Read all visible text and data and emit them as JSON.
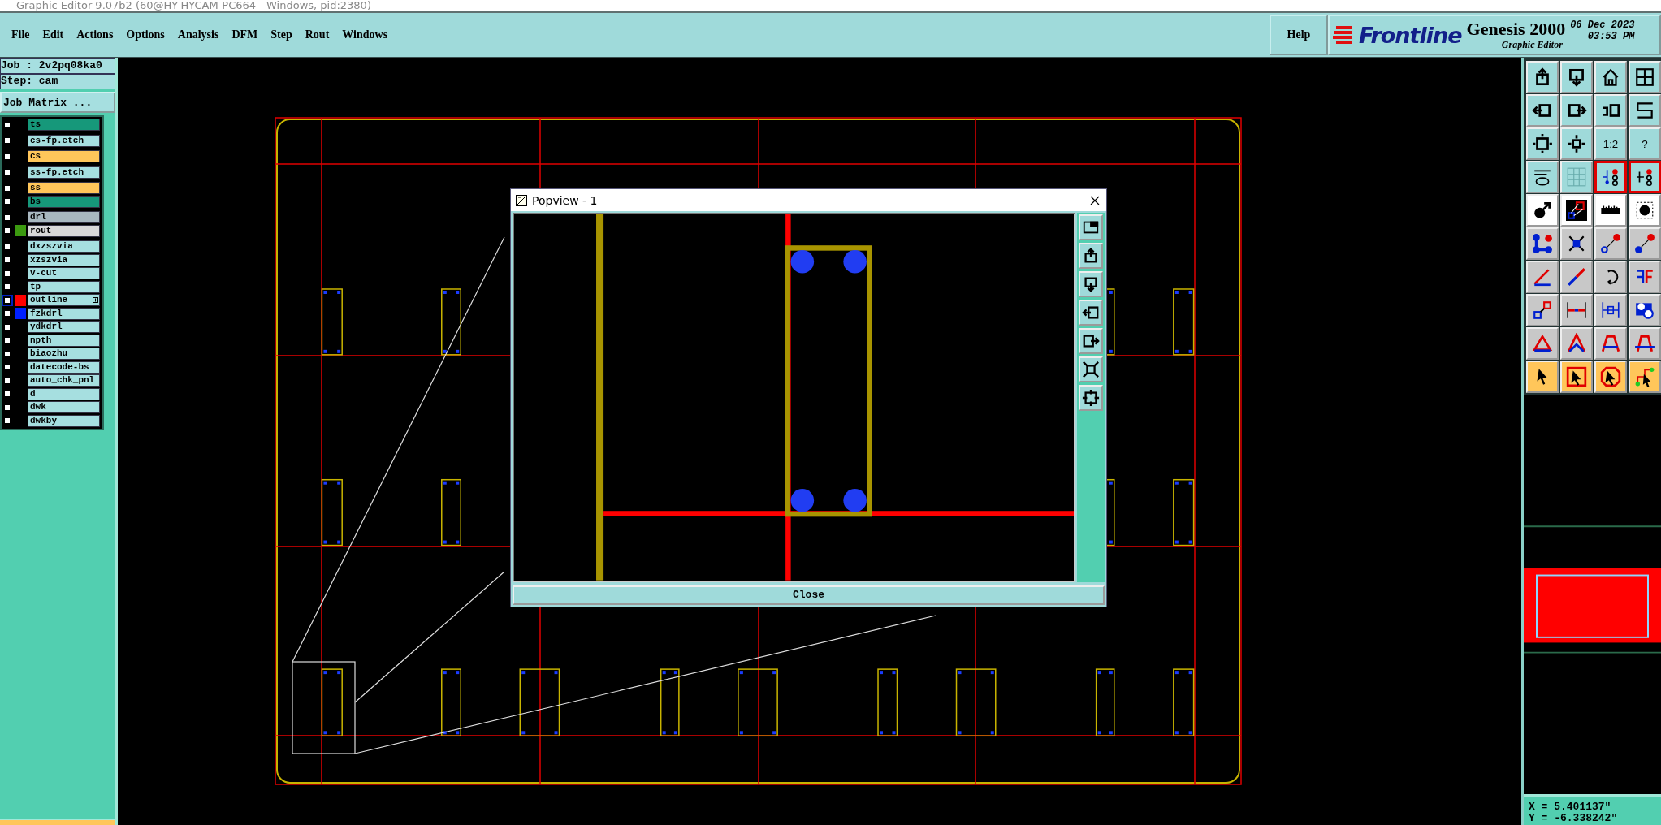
{
  "window": {
    "title": "Graphic Editor 9.07b2 (60@HY-HYCAM-PC664 - Windows, pid:2380)"
  },
  "menu": [
    "File",
    "Edit",
    "Actions",
    "Options",
    "Analysis",
    "DFM",
    "Step",
    "Rout",
    "Windows"
  ],
  "help": "Help",
  "brand": {
    "logo": "Frontline",
    "product": "Genesis 2000",
    "subtitle": "Graphic Editor",
    "date": "06 Dec 2023",
    "time": "03:53 PM"
  },
  "job": {
    "job": "Job : 2v2pq08ka0",
    "step": "Step: cam",
    "matrix_button": "Job Matrix ..."
  },
  "layer_groups": [
    [
      {
        "name": "ts",
        "color": "#16987a",
        "checked": false,
        "focused": false,
        "expandable": false
      }
    ],
    [
      {
        "name": "cs-fp.etch",
        "color": "#a6dfe0",
        "checked": false,
        "focused": false,
        "expandable": false
      }
    ],
    [
      {
        "name": "cs",
        "color": "#ffc65a",
        "checked": false,
        "focused": false,
        "expandable": false
      }
    ],
    [
      {
        "name": "ss-fp.etch",
        "color": "#a6dfe0",
        "checked": false,
        "focused": false,
        "expandable": false
      }
    ],
    [
      {
        "name": "ss",
        "color": "#ffc65a",
        "checked": false,
        "focused": false,
        "expandable": false
      },
      {
        "name": "bs",
        "color": "#16987a",
        "checked": false,
        "focused": false,
        "expandable": false
      }
    ],
    [
      {
        "name": "drl",
        "color": "#a8b8c0",
        "checked": false,
        "focused": false,
        "expandable": false
      },
      {
        "name": "rout",
        "color": "#d8d8d8",
        "swatch": {
          "color": "#3c9a10"
        },
        "checked": false,
        "focused": false,
        "expandable": false
      }
    ],
    [
      {
        "name": "dxzszvia",
        "color": "#a6dfe0",
        "checked": false,
        "focused": false,
        "expandable": false
      },
      {
        "name": "xzszvia",
        "color": "#a6dfe0",
        "checked": false,
        "focused": false,
        "expandable": false
      },
      {
        "name": "v-cut",
        "color": "#a6dfe0",
        "checked": false,
        "focused": false,
        "expandable": false
      },
      {
        "name": "tp",
        "color": "#a6dfe0",
        "checked": false,
        "focused": false,
        "expandable": false
      },
      {
        "name": "outline",
        "color": "#a6dfe0",
        "swatch": {
          "color": "#ff0000"
        },
        "checked": false,
        "focused": true,
        "expandable": true
      },
      {
        "name": "fzkdrl",
        "color": "#a6dfe0",
        "swatch": {
          "color": "#0020ff"
        },
        "checked": false,
        "focused": false,
        "expandable": false
      },
      {
        "name": "ydkdrl",
        "color": "#a6dfe0",
        "checked": false,
        "focused": false,
        "expandable": false
      },
      {
        "name": "npth",
        "color": "#a6dfe0",
        "checked": false,
        "focused": false,
        "expandable": false
      },
      {
        "name": "biaozhu",
        "color": "#a6dfe0",
        "checked": false,
        "focused": false,
        "expandable": false
      },
      {
        "name": "datecode-bs",
        "color": "#a6dfe0",
        "checked": false,
        "focused": false,
        "expandable": false
      },
      {
        "name": "auto_chk_pnl",
        "color": "#a6dfe0",
        "checked": false,
        "focused": false,
        "expandable": false
      },
      {
        "name": "d",
        "color": "#a6dfe0",
        "checked": false,
        "focused": false,
        "expandable": false
      },
      {
        "name": "dwk",
        "color": "#a6dfe0",
        "checked": false,
        "focused": false,
        "expandable": false
      },
      {
        "name": "dwkby",
        "color": "#a6dfe0",
        "checked": false,
        "focused": false,
        "expandable": false
      }
    ]
  ],
  "popview": {
    "title": "Popview - 1",
    "close_button": "Close"
  },
  "tools": [
    {
      "kind": "nav",
      "active": false
    },
    {
      "kind": "nav",
      "active": false
    },
    {
      "kind": "nav",
      "active": false
    },
    {
      "kind": "nav",
      "active": false
    },
    {
      "kind": "nav",
      "active": false
    },
    {
      "kind": "nav",
      "active": false
    },
    {
      "kind": "nav",
      "active": false
    },
    {
      "kind": "nav",
      "active": false
    },
    {
      "kind": "nav",
      "active": false
    },
    {
      "kind": "nav",
      "active": false
    },
    {
      "kind": "nav",
      "active": false,
      "label": "1:2"
    },
    {
      "kind": "nav",
      "active": false,
      "label": "?"
    },
    {
      "kind": "nav",
      "active": false
    },
    {
      "kind": "nav",
      "active": false
    },
    {
      "kind": "nav",
      "active": true
    },
    {
      "kind": "nav",
      "active": true
    },
    {
      "kind": "measure",
      "active": false
    },
    {
      "kind": "measure",
      "active": false
    },
    {
      "kind": "measure",
      "active": false
    },
    {
      "kind": "measure",
      "active": false
    },
    {
      "kind": "edit",
      "active": false
    },
    {
      "kind": "edit",
      "active": false
    },
    {
      "kind": "edit",
      "active": false
    },
    {
      "kind": "edit",
      "active": false
    },
    {
      "kind": "edit",
      "active": false
    },
    {
      "kind": "edit",
      "active": false
    },
    {
      "kind": "edit",
      "active": false
    },
    {
      "kind": "edit",
      "active": false
    },
    {
      "kind": "edit",
      "active": false
    },
    {
      "kind": "edit",
      "active": false
    },
    {
      "kind": "edit",
      "active": false
    },
    {
      "kind": "edit",
      "active": false
    },
    {
      "kind": "edit",
      "active": false
    },
    {
      "kind": "edit",
      "active": false
    },
    {
      "kind": "edit",
      "active": false
    },
    {
      "kind": "edit",
      "active": false
    },
    {
      "kind": "select",
      "active": false
    },
    {
      "kind": "select",
      "active": false
    },
    {
      "kind": "select",
      "active": false
    },
    {
      "kind": "select",
      "active": false
    }
  ],
  "coordinates": {
    "x": "X = 5.401137\"",
    "y": "Y = -6.338242\""
  }
}
